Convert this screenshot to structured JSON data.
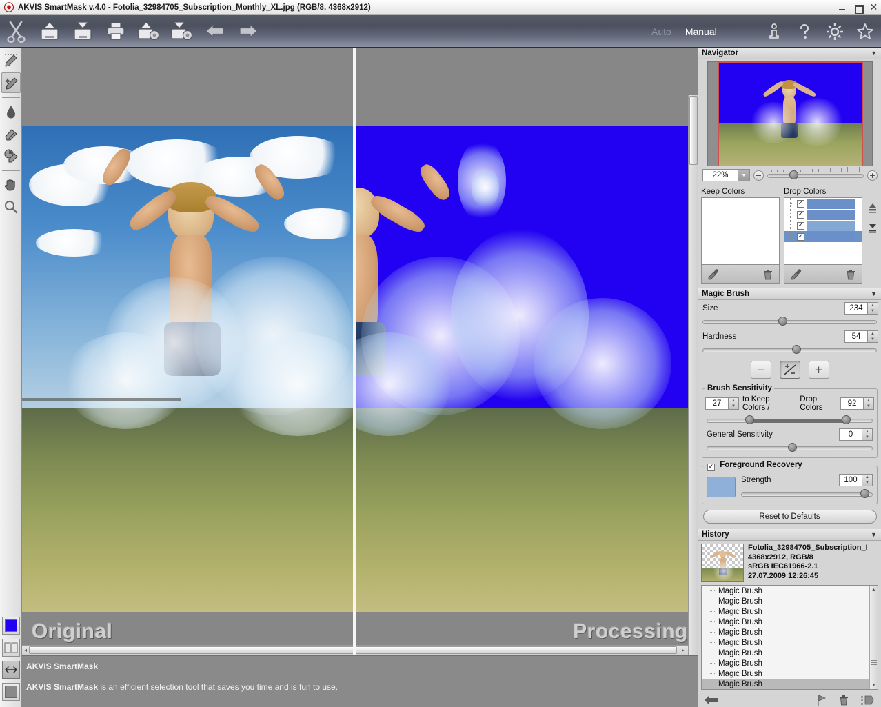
{
  "window": {
    "title": "AKVIS SmartMask v.4.0 - Fotolia_32984705_Subscription_Monthly_XL.jpg (RGB/8, 4368x2912)",
    "controls": {
      "minimize": "minimize-icon",
      "restore": "restore-icon",
      "close": "close-icon"
    }
  },
  "toolbar": {
    "buttons": [
      {
        "name": "scissors-logo-icon",
        "label": "scissors"
      },
      {
        "name": "open-image-button",
        "label": "Open Image"
      },
      {
        "name": "save-image-button",
        "label": "Save Image"
      },
      {
        "name": "print-image-button",
        "label": "Print Image"
      },
      {
        "name": "load-preset-button",
        "label": "Load Preset"
      },
      {
        "name": "save-preset-button",
        "label": "Save Preset"
      },
      {
        "name": "undo-button",
        "label": "Undo"
      },
      {
        "name": "redo-button",
        "label": "Redo"
      }
    ],
    "mode_auto": "Auto",
    "mode_manual": "Manual",
    "help_icons": [
      {
        "name": "info-icon",
        "label": "Information"
      },
      {
        "name": "help-icon",
        "label": "Help"
      },
      {
        "name": "preferences-icon",
        "label": "Preferences"
      },
      {
        "name": "favorites-icon",
        "label": "About"
      }
    ]
  },
  "left_tools": [
    {
      "name": "selection-brush-tool",
      "label": "Selection Brush",
      "selected": false
    },
    {
      "name": "magic-brush-tool",
      "label": "Magic Brush",
      "selected": true
    },
    {
      "name": "drop-tool",
      "label": "Drop",
      "selected": false
    },
    {
      "name": "eraser-tool",
      "label": "Eraser",
      "selected": false
    },
    {
      "name": "history-brush-tool",
      "label": "History Brush",
      "selected": false
    },
    {
      "name": "hand-tool",
      "label": "Hand",
      "selected": false
    },
    {
      "name": "zoom-tool",
      "label": "Zoom",
      "selected": false
    }
  ],
  "left_bottom": {
    "background_color": "#2200f2",
    "split_view_label": "Split View",
    "swap_view_label": "Swap View",
    "secondary_color": "#8a8a8a"
  },
  "canvas": {
    "label_original": "Original",
    "label_processing": "Processing"
  },
  "hintbar": {
    "title": "AKVIS SmartMask",
    "body_bold": "AKVIS SmartMask",
    "body_rest": " is an efficient selection tool that saves you time and is fun to use."
  },
  "navigator": {
    "title": "Navigator",
    "zoom_value": "22%",
    "zoom_out_label": "−",
    "zoom_in_label": "+"
  },
  "colors": {
    "keep_title": "Keep Colors",
    "drop_title": "Drop Colors",
    "keep_items": [],
    "drop_items": [
      {
        "checked": true,
        "color": "#6b8fc8"
      },
      {
        "checked": true,
        "color": "#6b8fc8"
      },
      {
        "checked": true,
        "color": "#84a8d4"
      },
      {
        "checked": true,
        "color": "#6b8fc8",
        "selected": true
      }
    ],
    "eyedropper_label": "Pick Color",
    "trash_label": "Delete Color",
    "add_up_label": "Move Up",
    "add_down_label": "Move Down"
  },
  "magic_brush": {
    "title": "Magic Brush",
    "size_label": "Size",
    "size_value": "234",
    "hardness_label": "Hardness",
    "hardness_value": "54",
    "mode_minus": "−",
    "mode_plusminus": "+/−",
    "mode_plus": "+",
    "sensitivity_group": "Brush Sensitivity",
    "keep_value": "27",
    "keep_text": "to Keep Colors /",
    "drop_text": "Drop Colors",
    "drop_value": "92",
    "general_label": "General Sensitivity",
    "general_value": "0",
    "foreground_group": "Foreground Recovery",
    "foreground_checked": true,
    "foreground_swatch": "#8fb0d8",
    "strength_label": "Strength",
    "strength_value": "100",
    "reset_label": "Reset to Defaults"
  },
  "history": {
    "title": "History",
    "meta_line1": "Fotolia_32984705_Subscription_I",
    "meta_line2": "4368x2912, RGB/8",
    "meta_line3": "sRGB IEC61966-2.1",
    "meta_line4": "27.07.2009 12:26:45",
    "items": [
      {
        "label": "Magic Brush",
        "selected": false
      },
      {
        "label": "Magic Brush",
        "selected": false
      },
      {
        "label": "Magic Brush",
        "selected": false
      },
      {
        "label": "Magic Brush",
        "selected": false
      },
      {
        "label": "Magic Brush",
        "selected": false
      },
      {
        "label": "Magic Brush",
        "selected": false
      },
      {
        "label": "Magic Brush",
        "selected": false
      },
      {
        "label": "Magic Brush",
        "selected": false
      },
      {
        "label": "Magic Brush",
        "selected": false
      },
      {
        "label": "Magic Brush",
        "selected": true
      }
    ],
    "back_label": "Step Back",
    "flag_label": "Set Marker",
    "delete_label": "Delete",
    "settings_label": "History Options"
  }
}
